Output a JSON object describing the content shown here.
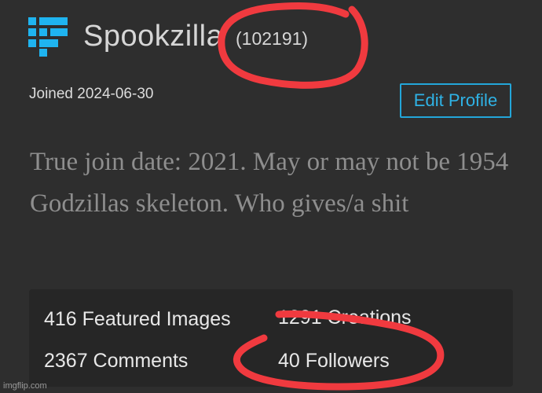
{
  "profile": {
    "avatar_icon": "pixel-avatar-icon",
    "avatar_color": "#1fb4f0",
    "username": "Spookzilla",
    "points": "(102191)",
    "joined": "Joined 2024-06-30",
    "edit_label": "Edit Profile",
    "bio": "True join date: 2021. May or may not be 1954 Godzillas skeleton. Who gives/a shit"
  },
  "stats": {
    "featured_images": "416 Featured Images",
    "creations": "1291 Creations",
    "comments": "2367 Comments",
    "followers": "40 Followers"
  },
  "watermark": "imgflip.com",
  "annotation_color": "#f03a3f"
}
